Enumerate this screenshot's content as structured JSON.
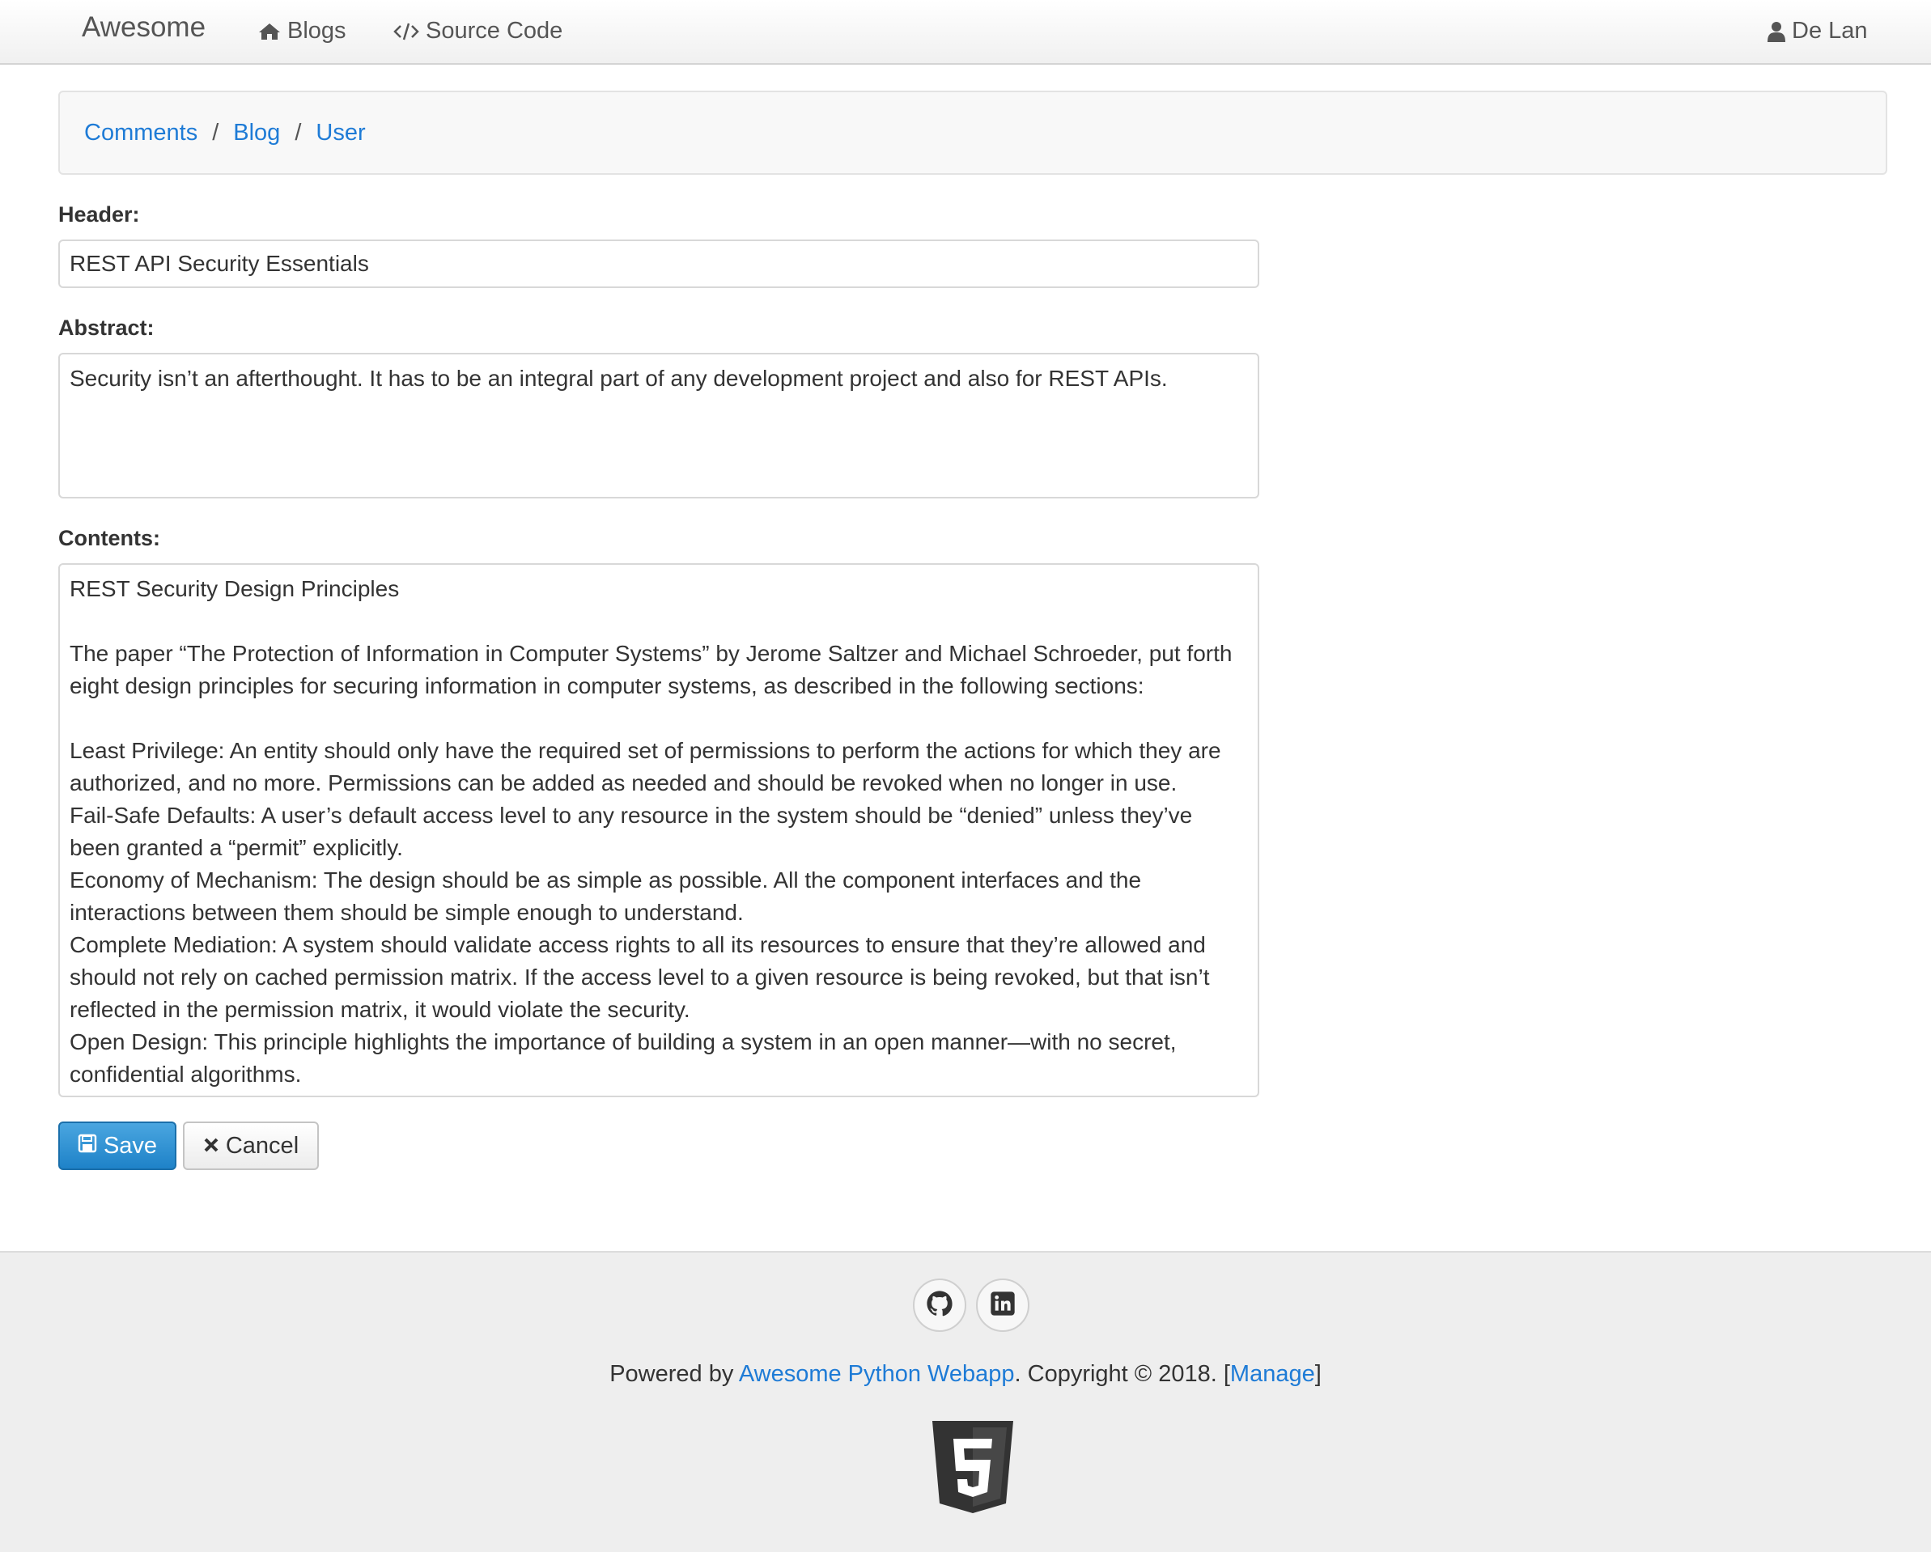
{
  "navbar": {
    "brand": "Awesome",
    "blogs_label": "Blogs",
    "source_label": "Source Code",
    "user_name": "De Lan"
  },
  "breadcrumb": [
    "Comments",
    "Blog",
    "User"
  ],
  "form": {
    "header_label": "Header:",
    "header_value": "REST API Security Essentials",
    "abstract_label": "Abstract:",
    "abstract_value": "Security isn’t an afterthought. It has to be an integral part of any development project and also for REST APIs.",
    "contents_label": "Contents:",
    "contents_value": "REST Security Design Principles\n\nThe paper “The Protection of Information in Computer Systems” by Jerome Saltzer and Michael Schroeder, put forth eight design principles for securing information in computer systems, as described in the following sections:\n\nLeast Privilege: An entity should only have the required set of permissions to perform the actions for which they are authorized, and no more. Permissions can be added as needed and should be revoked when no longer in use.\nFail-Safe Defaults: A user’s default access level to any resource in the system should be “denied” unless they’ve been granted a “permit” explicitly.\nEconomy of Mechanism: The design should be as simple as possible. All the component interfaces and the interactions between them should be simple enough to understand.\nComplete Mediation: A system should validate access rights to all its resources to ensure that they’re allowed and should not rely on cached permission matrix. If the access level to a given resource is being revoked, but that isn’t reflected in the permission matrix, it would violate the security.\nOpen Design: This principle highlights the importance of building a system in an open manner—with no secret, confidential algorithms.",
    "save_label": "Save",
    "cancel_label": "Cancel"
  },
  "footer": {
    "powered_prefix": "Powered by ",
    "powered_link": "Awesome Python Webapp",
    "copyright": ". Copyright © 2018. [",
    "manage_link": "Manage",
    "close_bracket": "]"
  },
  "colors": {
    "link": "#1e7bd6",
    "primary_button": "#2a8fd3",
    "footer_bg": "#eeeeee"
  }
}
